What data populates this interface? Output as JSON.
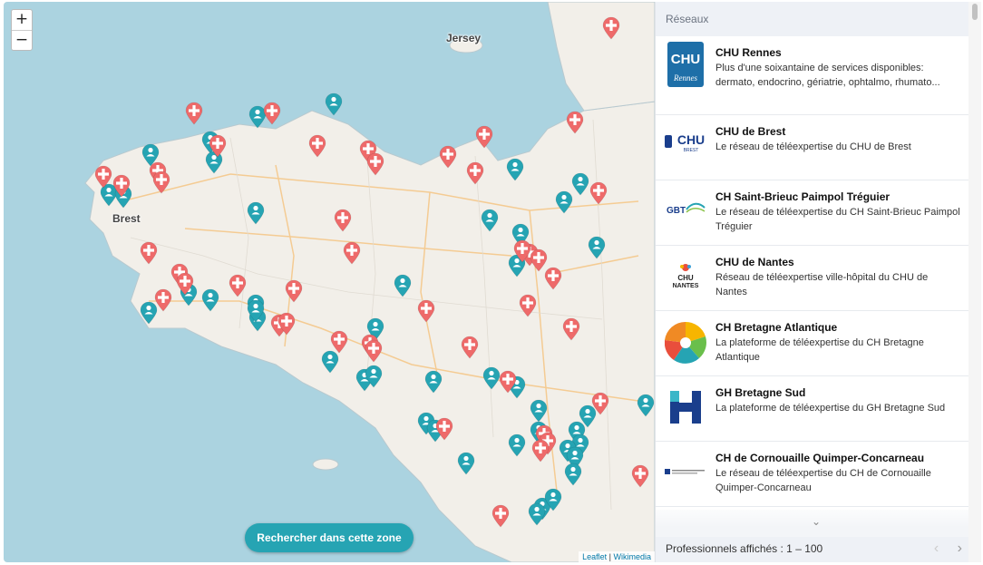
{
  "map": {
    "zoom_in": "+",
    "zoom_out": "−",
    "labels": {
      "jersey": "Jersey",
      "brest": "Brest"
    },
    "search_zone_button": "Rechercher dans cette zone",
    "attribution": {
      "leaflet": "Leaflet",
      "separator": "|",
      "wikimedia": "Wikimedia"
    },
    "colors": {
      "sea": "#abd3e0",
      "land": "#f2efe9",
      "hospital_marker": "#ee6a6a",
      "professional_marker": "#26a4b3"
    }
  },
  "panel": {
    "header": "Réseaux",
    "networks": [
      {
        "name": "CHU Rennes",
        "description": "Plus d'une soixantaine de services disponibles: dermato, endocrino, gériatrie, ophtalmo, rhumato...",
        "logo_icon": "chu-rennes-logo"
      },
      {
        "name": "CHU de Brest",
        "description": "Le réseau de téléexpertise du CHU de Brest",
        "logo_icon": "chu-brest-logo"
      },
      {
        "name": "CH Saint-Brieuc Paimpol Tréguier",
        "description": "Le réseau de téléexpertise du CH Saint-Brieuc Paimpol Tréguier",
        "logo_icon": "ch-saint-brieuc-logo"
      },
      {
        "name": "CHU de Nantes",
        "description": "Réseau de téléexpertise ville-hôpital du CHU de Nantes",
        "logo_icon": "chu-nantes-logo"
      },
      {
        "name": "CH Bretagne Atlantique",
        "description": "La plateforme de téléexpertise du CH Bretagne Atlantique",
        "logo_icon": "ch-bretagne-atlantique-logo"
      },
      {
        "name": "GH Bretagne Sud",
        "description": "La plateforme de téléexpertise du GH Bretagne Sud",
        "logo_icon": "gh-bretagne-sud-logo"
      },
      {
        "name": "CH de Cornouaille Quimper-Concarneau",
        "description": "Le réseau de téléexpertise du CH de Cornouaille Quimper-Concarneau",
        "logo_icon": "ch-cornouaille-logo"
      }
    ],
    "footer": "Professionnels affichés : 1 – 100",
    "pager": {
      "prev": "‹",
      "next": "›"
    }
  }
}
